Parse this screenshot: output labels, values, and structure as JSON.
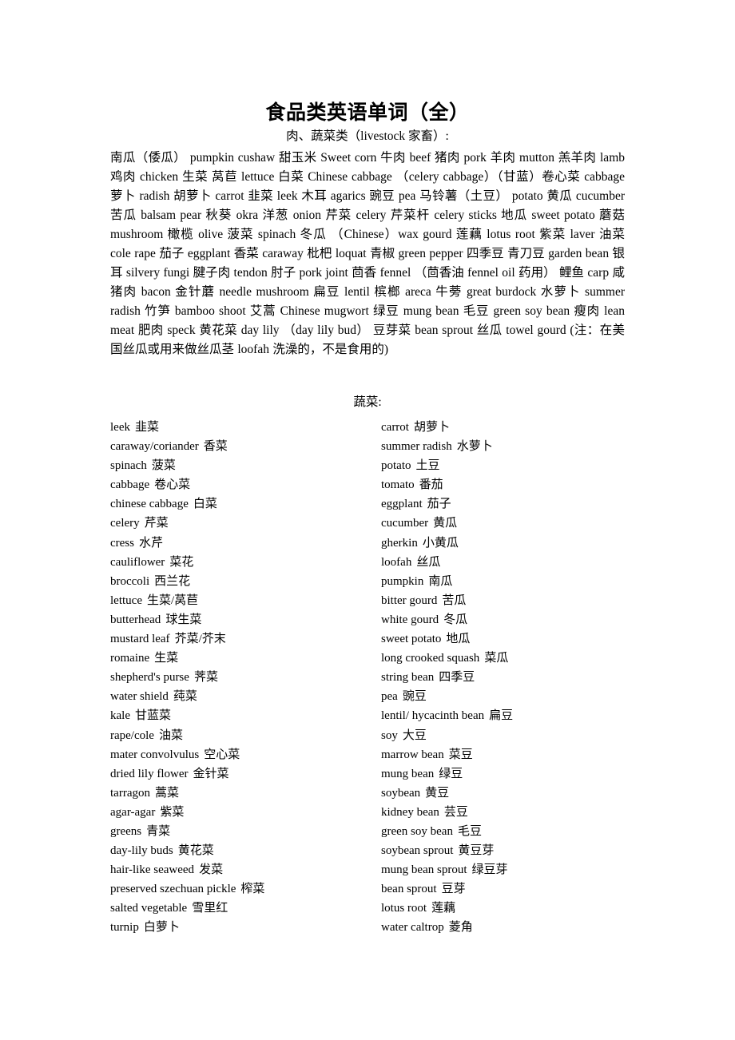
{
  "document": {
    "title": "食品类英语单词（全）",
    "section_one_heading": "肉、蔬菜类（livestock 家畜）:",
    "section_two_heading": "蔬菜:",
    "paragraph": "南瓜（倭瓜） pumpkin cushaw 甜玉米 Sweet corn 牛肉 beef 猪肉 pork 羊肉 mutton 羔羊肉 lamb 鸡肉 chicken 生菜 莴苣 lettuce 白菜 Chinese cabbage （celery cabbage）（甘蓝）卷心菜 cabbage 萝卜 radish 胡萝卜 carrot 韭菜 leek 木耳 agarics 豌豆 pea 马铃薯（土豆） potato 黄瓜 cucumber 苦瓜 balsam pear 秋葵 okra 洋葱 onion 芹菜 celery 芹菜杆 celery sticks 地瓜 sweet potato 蘑菇 mushroom 橄榄 olive 菠菜 spinach 冬瓜 （Chinese）wax gourd 莲藕 lotus root 紫菜 laver 油菜 cole rape 茄子 eggplant 香菜 caraway 枇杷 loquat 青椒 green pepper 四季豆 青刀豆 garden bean 银耳 silvery fungi 腱子肉 tendon 肘子 pork joint 茴香 fennel （茴香油 fennel oil 药用） 鲤鱼 carp 咸猪肉 bacon 金针蘑 needle mushroom 扁豆 lentil 槟榔 areca 牛蒡 great burdock 水萝卜 summer radish 竹笋 bamboo shoot 艾蒿 Chinese mugwort 绿豆 mung bean 毛豆 green soy bean 瘦肉 lean meat 肥肉 speck 黄花菜 day lily （day lily bud） 豆芽菜 bean sprout 丝瓜 towel gourd (注：在美国丝瓜或用来做丝瓜茎 loofah 洗澡的，不是食用的)"
  },
  "vegetable_list": {
    "left_column": [
      {
        "en": "leek",
        "cn": "韭菜"
      },
      {
        "en": "caraway/coriander",
        "cn": "香菜"
      },
      {
        "en": "spinach",
        "cn": "菠菜"
      },
      {
        "en": "cabbage",
        "cn": "卷心菜"
      },
      {
        "en": "chinese cabbage",
        "cn": "白菜"
      },
      {
        "en": "celery",
        "cn": "芹菜"
      },
      {
        "en": "cress",
        "cn": "水芹"
      },
      {
        "en": "cauliflower",
        "cn": "菜花"
      },
      {
        "en": "broccoli",
        "cn": "西兰花"
      },
      {
        "en": "lettuce",
        "cn": "生菜/莴苣"
      },
      {
        "en": "butterhead",
        "cn": "球生菜"
      },
      {
        "en": "mustard leaf",
        "cn": "芥菜/芥末"
      },
      {
        "en": "romaine",
        "cn": "生菜"
      },
      {
        "en": "shepherd's purse",
        "cn": "荠菜"
      },
      {
        "en": "water shield",
        "cn": "莼菜"
      },
      {
        "en": "kale",
        "cn": "甘蓝菜"
      },
      {
        "en": "rape/cole",
        "cn": "油菜"
      },
      {
        "en": "mater convolvulus",
        "cn": "空心菜"
      },
      {
        "en": "dried lily flower",
        "cn": "金针菜"
      },
      {
        "en": "tarragon",
        "cn": "蒿菜"
      },
      {
        "en": "agar-agar",
        "cn": "紫菜"
      },
      {
        "en": "greens",
        "cn": "青菜"
      },
      {
        "en": "day-lily buds",
        "cn": "黄花菜"
      },
      {
        "en": "hair-like seaweed",
        "cn": "发菜"
      },
      {
        "en": "preserved szechuan pickle",
        "cn": "榨菜"
      },
      {
        "en": "salted vegetable",
        "cn": "雪里红"
      },
      {
        "en": "turnip",
        "cn": "白萝卜"
      }
    ],
    "right_column": [
      {
        "en": "carrot",
        "cn": "胡萝卜"
      },
      {
        "en": "summer radish",
        "cn": "水萝卜"
      },
      {
        "en": "potato",
        "cn": "土豆"
      },
      {
        "en": "tomato",
        "cn": "番茄"
      },
      {
        "en": "eggplant",
        "cn": "茄子"
      },
      {
        "en": "cucumber",
        "cn": "黄瓜"
      },
      {
        "en": "gherkin",
        "cn": "小黄瓜"
      },
      {
        "en": "loofah",
        "cn": "丝瓜"
      },
      {
        "en": "pumpkin",
        "cn": "南瓜"
      },
      {
        "en": "bitter gourd",
        "cn": "苦瓜"
      },
      {
        "en": "white gourd",
        "cn": "冬瓜"
      },
      {
        "en": "sweet potato",
        "cn": "地瓜"
      },
      {
        "en": "long crooked squash",
        "cn": "菜瓜"
      },
      {
        "en": "string bean",
        "cn": "四季豆"
      },
      {
        "en": "pea",
        "cn": "豌豆"
      },
      {
        "en": "lentil/ hycacinth bean",
        "cn": "扁豆"
      },
      {
        "en": "soy",
        "cn": "大豆"
      },
      {
        "en": "marrow bean",
        "cn": "菜豆"
      },
      {
        "en": "mung bean",
        "cn": "绿豆"
      },
      {
        "en": "soybean",
        "cn": "黄豆"
      },
      {
        "en": "kidney bean",
        "cn": "芸豆"
      },
      {
        "en": "green soy bean",
        "cn": "毛豆"
      },
      {
        "en": "soybean sprout",
        "cn": "黄豆芽"
      },
      {
        "en": "mung bean sprout",
        "cn": "绿豆芽"
      },
      {
        "en": "bean sprout",
        "cn": "豆芽"
      },
      {
        "en": "lotus root",
        "cn": "莲藕"
      },
      {
        "en": "water caltrop",
        "cn": "菱角"
      }
    ]
  }
}
